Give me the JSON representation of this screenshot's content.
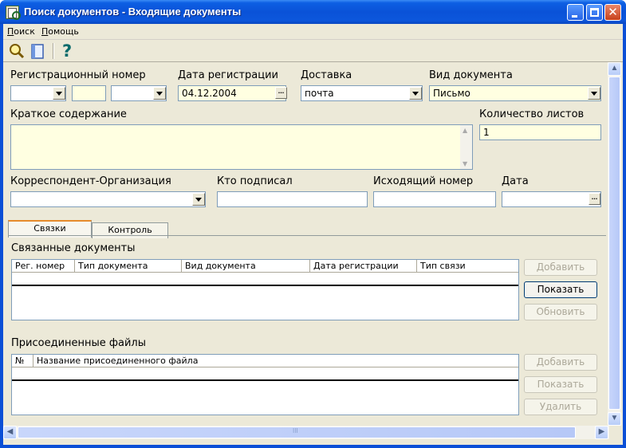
{
  "window": {
    "title": "Поиск документов - Входящие документы"
  },
  "menu": {
    "items": [
      "Поиск",
      "Помощь"
    ]
  },
  "toolbar": {
    "buttons": [
      "search-icon",
      "document-icon",
      "help-icon"
    ],
    "help_glyph": "?"
  },
  "form": {
    "reg_number_label": "Регистрационный номер",
    "reg_date_label": "Дата регистрации",
    "reg_date_value": "04.12.2004",
    "delivery_label": "Доставка",
    "delivery_value": "почта",
    "doc_kind_label": "Вид документа",
    "doc_kind_value": "Письмо",
    "summary_label": "Краткое содержание",
    "sheets_label": "Количество листов",
    "sheets_value": "1",
    "correspondent_label": "Корреспондент-Организация",
    "signed_by_label": "Кто подписал",
    "outgoing_number_label": "Исходящий номер",
    "date_label": "Дата",
    "ellipsis": "..."
  },
  "tabs": [
    {
      "label": "Связки",
      "active": true
    },
    {
      "label": "Контроль",
      "active": false
    }
  ],
  "linked_docs": {
    "title": "Связанные документы",
    "columns": [
      "Рег. номер",
      "Тип документа",
      "Вид документа",
      "Дата регистрации",
      "Тип связи"
    ],
    "buttons": {
      "add": "Добавить",
      "show": "Показать",
      "refresh": "Обновить"
    }
  },
  "attached_files": {
    "title": "Присоединенные файлы",
    "columns": [
      "№",
      "Название присоединенного файла"
    ],
    "buttons": {
      "add": "Добавить",
      "show": "Показать",
      "delete": "Удалить"
    }
  },
  "scroll": {
    "grip": "III"
  },
  "colors": {
    "title_bar": "#0a52d8",
    "client_bg": "#ece9d8",
    "field_highlight": "#ffffe1",
    "field_border": "#7f9db9"
  }
}
